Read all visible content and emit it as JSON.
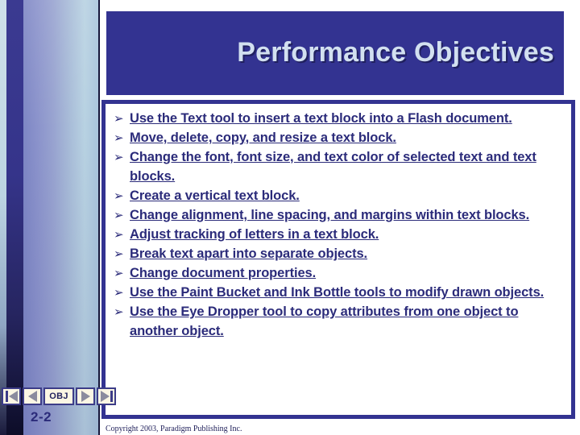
{
  "slide": {
    "title": "Performance Objectives",
    "slide_number": "2-2",
    "copyright": "Copyright 2003, Paradigm Publishing Inc.",
    "bullet_marker": "➢",
    "colors": {
      "banner_blue": "#333391",
      "title_text": "#d2e0f0",
      "body_text": "#2b2b7a",
      "button_face": "#fbf6e4",
      "triangle_gray": "#8b8b9e"
    },
    "objectives": [
      "Use the Text tool to insert a text block into a Flash document.",
      "Move, delete, copy, and resize a text block.",
      "Change the font, font size, and text color of selected text and text blocks.",
      "Create a vertical text block.",
      "Change alignment, line spacing, and margins within text blocks.",
      "Adjust tracking of letters in a text block.",
      "Break text apart into separate objects.",
      "Change document properties.",
      "Use the Paint Bucket and Ink Bottle tools to modify drawn objects.",
      "Use the Eye Dropper tool to copy attributes from one object to another object."
    ]
  },
  "navigation": {
    "first_label": "first-slide",
    "previous_label": "previous-slide",
    "obj_label": "OBJ",
    "next_label": "next-slide",
    "last_label": "last-slide"
  }
}
